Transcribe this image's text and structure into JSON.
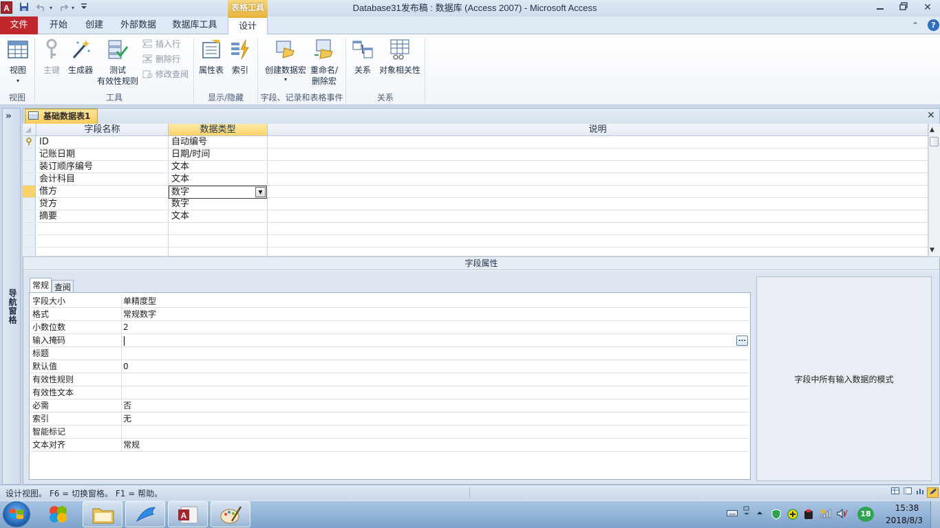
{
  "window": {
    "app_icon": "A",
    "title": "Database31发布稿 : 数据库 (Access 2007)  -  Microsoft Access",
    "context_tab_header": "表格工具",
    "minimize": "▭",
    "restore": "⧉",
    "close": "✕"
  },
  "qat": {
    "dropdown": "▾"
  },
  "ribbon": {
    "tabs": [
      "文件",
      "开始",
      "创建",
      "外部数据",
      "数据库工具",
      "设计"
    ],
    "active_tab": "设计",
    "minimize_glyph": "⌃",
    "help_glyph": "?",
    "groups": {
      "view": {
        "label": "视图",
        "button": "视图",
        "dropdown": "▾"
      },
      "tools": {
        "label": "工具",
        "primary_key": "主键",
        "builder": "生成器",
        "test_rules_line1": "测试",
        "test_rules_line2": "有效性规则",
        "insert_rows": "插入行",
        "delete_rows": "删除行",
        "modify_lookups": "修改查阅"
      },
      "show_hide": {
        "label": "显示/隐藏",
        "property_sheet": "属性表",
        "indexes": "索引"
      },
      "events": {
        "label": "字段、记录和表格事件",
        "create_macro": "创建数据宏",
        "create_macro_dropdown": "▾",
        "rename_macro_line1": "重命名/",
        "rename_macro_line2": "删除宏"
      },
      "relationships": {
        "label": "关系",
        "relationships": "关系",
        "dependencies": "对象相关性"
      }
    }
  },
  "nav_pane": {
    "toggle": "»",
    "label": "导航窗格"
  },
  "document": {
    "tab_title": "基础数据表1",
    "close_glyph": "✕",
    "grid": {
      "headers": {
        "field_name": "字段名称",
        "data_type": "数据类型",
        "description": "说明"
      },
      "rows": [
        {
          "name": "ID",
          "type": "自动编号",
          "key": true
        },
        {
          "name": "记账日期",
          "type": "日期/时间"
        },
        {
          "name": "装订顺序编号",
          "type": "文本"
        },
        {
          "name": "会计科目",
          "type": "文本"
        },
        {
          "name": "借方",
          "type": "数字",
          "current": true
        },
        {
          "name": "贷方",
          "type": "数字"
        },
        {
          "name": "摘要",
          "type": "文本"
        }
      ],
      "combo_arrow": "▼",
      "scroll_up": "▲",
      "scroll_down": "▼"
    },
    "field_properties": {
      "band_title": "字段属性",
      "tabs": [
        "常规",
        "查阅"
      ],
      "rows": [
        {
          "name": "字段大小",
          "value": "单精度型"
        },
        {
          "name": "格式",
          "value": "常规数字"
        },
        {
          "name": "小数位数",
          "value": "2"
        },
        {
          "name": "输入掩码",
          "value": ""
        },
        {
          "name": "标题",
          "value": ""
        },
        {
          "name": "默认值",
          "value": "0"
        },
        {
          "name": "有效性规则",
          "value": ""
        },
        {
          "name": "有效性文本",
          "value": ""
        },
        {
          "name": "必需",
          "value": "否"
        },
        {
          "name": "索引",
          "value": "无"
        },
        {
          "name": "智能标记",
          "value": ""
        },
        {
          "name": "文本对齐",
          "value": "常规"
        }
      ],
      "builder_button": "...",
      "hint": "字段中所有输入数据的模式"
    }
  },
  "status_bar": {
    "text": "设计视图。   F6 = 切换窗格。   F1 = 帮助。"
  },
  "taskbar": {
    "tray_badge": "18",
    "time": "15:38",
    "date": "2018/8/3"
  },
  "colors": {
    "file_tab": "#c0272d",
    "context_accent": "#e9b640",
    "current_row": "#f9d267"
  }
}
